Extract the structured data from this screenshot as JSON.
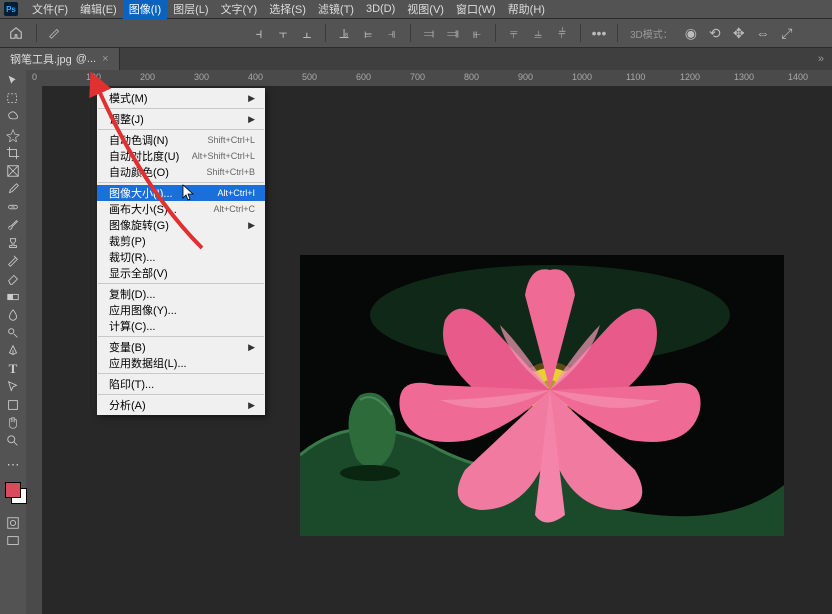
{
  "menubar": {
    "logo": "Ps",
    "items": [
      "文件(F)",
      "编辑(E)",
      "图像(I)",
      "图层(L)",
      "文字(Y)",
      "选择(S)",
      "滤镜(T)",
      "3D(D)",
      "视图(V)",
      "窗口(W)",
      "帮助(H)"
    ],
    "open_index": 2
  },
  "options": {
    "threeDMode": "3D模式："
  },
  "tab": {
    "name": "钢笔工具.jpg",
    "zoom": "@..."
  },
  "ruler_h": [
    "0",
    "100",
    "200",
    "300",
    "400",
    "500",
    "600",
    "700",
    "800",
    "900",
    "1000",
    "1100",
    "1200",
    "1300",
    "1400"
  ],
  "dropdown": [
    {
      "type": "sub",
      "label": "模式(M)"
    },
    {
      "type": "div"
    },
    {
      "type": "sub",
      "label": "调整(J)"
    },
    {
      "type": "div"
    },
    {
      "type": "item",
      "label": "自动色调(N)",
      "shortcut": "Shift+Ctrl+L"
    },
    {
      "type": "item",
      "label": "自动对比度(U)",
      "shortcut": "Alt+Shift+Ctrl+L"
    },
    {
      "type": "item",
      "label": "自动颜色(O)",
      "shortcut": "Shift+Ctrl+B"
    },
    {
      "type": "div"
    },
    {
      "type": "item",
      "label": "图像大小(I)...",
      "shortcut": "Alt+Ctrl+I",
      "hl": true
    },
    {
      "type": "item",
      "label": "画布大小(S)...",
      "shortcut": "Alt+Ctrl+C"
    },
    {
      "type": "sub",
      "label": "图像旋转(G)"
    },
    {
      "type": "item",
      "label": "裁剪(P)"
    },
    {
      "type": "item",
      "label": "裁切(R)..."
    },
    {
      "type": "item",
      "label": "显示全部(V)"
    },
    {
      "type": "div"
    },
    {
      "type": "item",
      "label": "复制(D)..."
    },
    {
      "type": "item",
      "label": "应用图像(Y)..."
    },
    {
      "type": "item",
      "label": "计算(C)..."
    },
    {
      "type": "div"
    },
    {
      "type": "sub",
      "label": "变量(B)"
    },
    {
      "type": "item",
      "label": "应用数据组(L)..."
    },
    {
      "type": "div"
    },
    {
      "type": "item",
      "label": "陷印(T)..."
    },
    {
      "type": "div"
    },
    {
      "type": "sub",
      "label": "分析(A)"
    }
  ]
}
